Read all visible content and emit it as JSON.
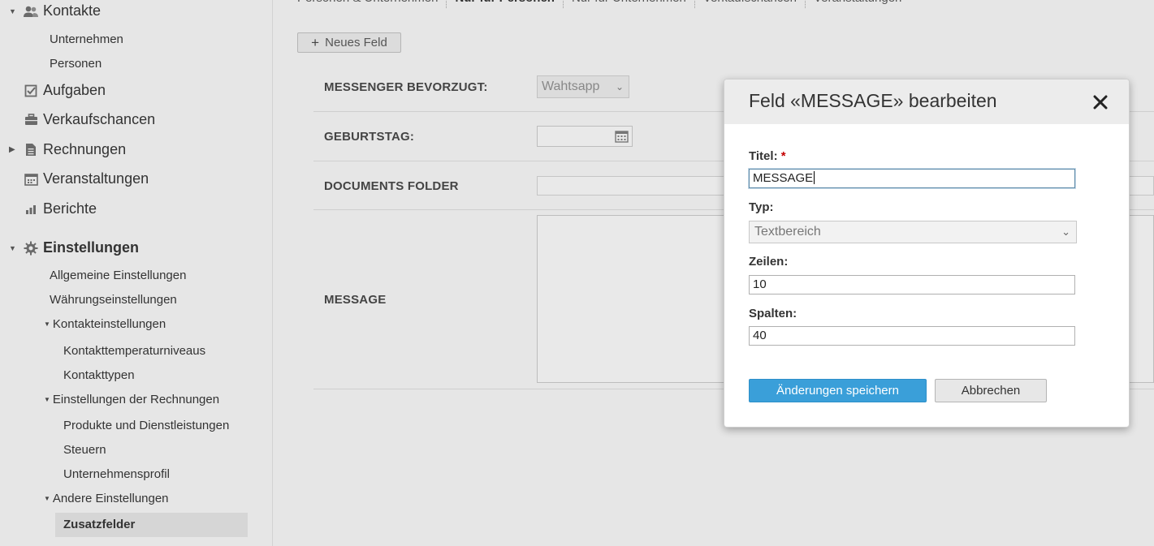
{
  "sidebar": {
    "contacts": {
      "label": "Kontakte",
      "icon": "people-icon"
    },
    "contacts_children": [
      "Unternehmen",
      "Personen"
    ],
    "tasks": {
      "label": "Aufgaben",
      "icon": "checkbox-icon"
    },
    "deals": {
      "label": "Verkaufschancen",
      "icon": "briefcase-icon"
    },
    "invoices": {
      "label": "Rechnungen",
      "icon": "document-icon"
    },
    "events": {
      "label": "Veranstaltungen",
      "icon": "calendar-icon"
    },
    "reports": {
      "label": "Berichte",
      "icon": "bar-chart-icon"
    },
    "settings": {
      "label": "Einstellungen",
      "icon": "gear-icon",
      "general": "Allgemeine Einstellungen",
      "currency": "Währungseinstellungen",
      "contact_settings": {
        "label": "Kontakteinstellungen",
        "children": [
          "Kontakttemperaturniveaus",
          "Kontakttypen"
        ]
      },
      "invoice_settings": {
        "label": "Einstellungen der Rechnungen",
        "children": [
          "Produkte und Dienstleistungen",
          "Steuern",
          "Unternehmensprofil"
        ]
      },
      "other_settings": {
        "label": "Andere Einstellungen",
        "active": "Zusatzfelder"
      }
    }
  },
  "tabs": [
    "Personen & Unternehmen",
    "Nur für Personen",
    "Nur für Unternehmen",
    "Verkaufschancen",
    "Veranstaltungen"
  ],
  "active_tab": "Nur für Personen",
  "new_field_button": "Neues Feld",
  "fields": {
    "messenger": {
      "label": "MESSENGER BEVORZUGT:",
      "value": "Wahtsapp"
    },
    "birthday": {
      "label": "GEBURTSTAG:"
    },
    "documents": {
      "label": "DOCUMENTS FOLDER"
    },
    "message": {
      "label": "MESSAGE"
    }
  },
  "modal": {
    "title": "Feld «MESSAGE» bearbeiten",
    "title_label": "Titel:",
    "required_mark": "*",
    "title_value": "MESSAGE",
    "type_label": "Typ:",
    "type_value": "Textbereich",
    "rows_label": "Zeilen:",
    "rows_value": "10",
    "cols_label": "Spalten:",
    "cols_value": "40",
    "save_button": "Änderungen speichern",
    "cancel_button": "Abbrechen"
  },
  "colors": {
    "primary_button": "#3a9fd9",
    "required": "#c40000",
    "background": "#e6e6e6"
  }
}
